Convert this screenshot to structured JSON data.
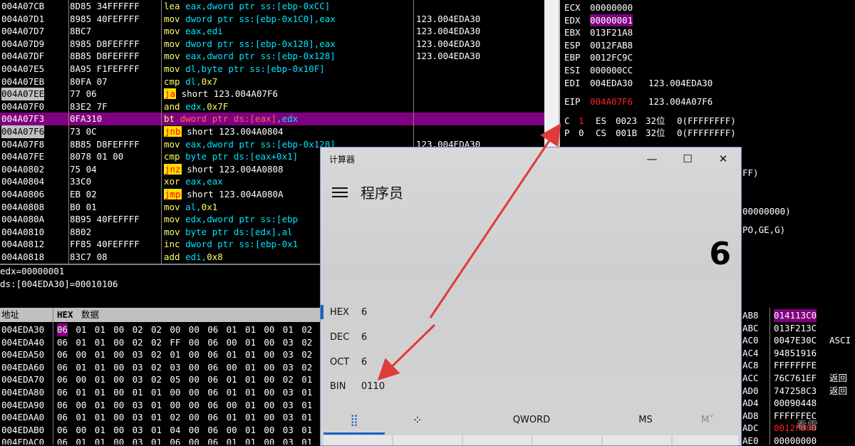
{
  "disasm": {
    "rows": [
      {
        "addr": "004A07CB",
        "hex": "8D85 34FFFFFF",
        "dis": [
          [
            "lea ",
            "mnem"
          ],
          [
            "eax,dword ptr ss:[ebp-0xCC]",
            "ops"
          ]
        ],
        "cmt": ""
      },
      {
        "addr": "004A07D1",
        "hex": "8985 40FEFFFF",
        "dis": [
          [
            "mov ",
            "mnem"
          ],
          [
            "dword ptr ss:[ebp-0x1C0],eax",
            "ops"
          ]
        ],
        "cmt": "123.004EDA30"
      },
      {
        "addr": "004A07D7",
        "hex": "8BC7",
        "dis": [
          [
            "mov ",
            "mnem"
          ],
          [
            "eax,edi",
            "ops"
          ]
        ],
        "cmt": "123.004EDA30"
      },
      {
        "addr": "004A07D9",
        "hex": "8985 D8FEFFFF",
        "dis": [
          [
            "mov ",
            "mnem"
          ],
          [
            "dword ptr ss:[ebp-0x128],eax",
            "ops"
          ]
        ],
        "cmt": "123.004EDA30"
      },
      {
        "addr": "004A07DF",
        "hex": "8B85 D8FEFFFF",
        "dis": [
          [
            "mov ",
            "mnem"
          ],
          [
            "eax,dword ptr ss:[ebp-0x128]",
            "ops"
          ]
        ],
        "cmt": "123.004EDA30"
      },
      {
        "addr": "004A07E5",
        "hex": "8A95 F1FEFFFF",
        "dis": [
          [
            "mov ",
            "mnem"
          ],
          [
            "dl,byte ptr ss:[ebp-0x10F]",
            "ops"
          ]
        ],
        "cmt": ""
      },
      {
        "addr": "004A07EB",
        "hex": "80FA 07",
        "dis": [
          [
            "cmp ",
            "mnem"
          ],
          [
            "dl,",
            "ops"
          ],
          [
            "0x7",
            "num"
          ]
        ],
        "cmt": ""
      },
      {
        "addr": "004A07EE",
        "hex": "77 06",
        "dis": [
          [
            "ja",
            "jmp"
          ],
          [
            " short 123.004A07F6",
            "plain"
          ]
        ],
        "cmt": "",
        "addrcls": "cur-addr"
      },
      {
        "addr": "004A07F0",
        "hex": "83E2 7F",
        "dis": [
          [
            "and ",
            "mnem"
          ],
          [
            "edx,",
            "ops"
          ],
          [
            "0x7F",
            "num"
          ]
        ],
        "cmt": ""
      },
      {
        "addr": "004A07F3",
        "hex": "0FA310",
        "dis": [
          [
            "bt ",
            "mnemhl"
          ],
          [
            "dword ptr ds:[eax]",
            "opshl"
          ],
          [
            ",edx",
            "plainhl"
          ]
        ],
        "cmt": "",
        "rowcls": "hl-purple"
      },
      {
        "addr": "004A07F6",
        "hex": "73 0C",
        "dis": [
          [
            "jnb",
            "jmp"
          ],
          [
            " short 123.004A0804",
            "plain"
          ]
        ],
        "cmt": "",
        "addrcls": "cur-addr"
      },
      {
        "addr": "004A07F8",
        "hex": "8B85 D8FEFFFF",
        "dis": [
          [
            "mov ",
            "mnem"
          ],
          [
            "eax,dword ptr ss:[ebp-0x128]",
            "ops"
          ]
        ],
        "cmt": "123.004EDA30"
      },
      {
        "addr": "004A07FE",
        "hex": "8078 01 00",
        "dis": [
          [
            "cmp ",
            "mnem"
          ],
          [
            "byte ptr ds:[eax+0x1]",
            "ops"
          ]
        ],
        "cmt": ""
      },
      {
        "addr": "004A0802",
        "hex": "75 04",
        "dis": [
          [
            "jnz",
            "jmp"
          ],
          [
            " short 123.004A0808",
            "plain"
          ]
        ],
        "cmt": ""
      },
      {
        "addr": "004A0804",
        "hex": "33C0",
        "dis": [
          [
            "xor ",
            "mnem"
          ],
          [
            "eax,eax",
            "ops"
          ]
        ],
        "cmt": ""
      },
      {
        "addr": "004A0806",
        "hex": "EB 02",
        "dis": [
          [
            "jmp",
            "jmp"
          ],
          [
            " short 123.004A080A",
            "plain"
          ]
        ],
        "cmt": ""
      },
      {
        "addr": "004A0808",
        "hex": "B0 01",
        "dis": [
          [
            "mov ",
            "mnem"
          ],
          [
            "al,",
            "ops"
          ],
          [
            "0x1",
            "num"
          ]
        ],
        "cmt": ""
      },
      {
        "addr": "004A080A",
        "hex": "8B95 40FEFFFF",
        "dis": [
          [
            "mov ",
            "mnem"
          ],
          [
            "edx,dword ptr ss:[ebp",
            "ops"
          ]
        ],
        "cmt": ""
      },
      {
        "addr": "004A0810",
        "hex": "8802",
        "dis": [
          [
            "mov ",
            "mnem"
          ],
          [
            "byte ptr ds:[edx],al",
            "ops"
          ]
        ],
        "cmt": ""
      },
      {
        "addr": "004A0812",
        "hex": "FF85 40FEFFFF",
        "dis": [
          [
            "inc ",
            "mnem"
          ],
          [
            "dword ptr ss:[ebp-0x1",
            "ops"
          ]
        ],
        "cmt": ""
      },
      {
        "addr": "004A0818",
        "hex": "83C7 08",
        "dis": [
          [
            "add ",
            "mnem"
          ],
          [
            "edi,",
            "ops"
          ],
          [
            "0x8",
            "num"
          ]
        ],
        "cmt": ""
      }
    ]
  },
  "info": {
    "line1": "edx=00000001",
    "line2": "ds:[004EDA30]=00010106"
  },
  "registers": {
    "top_partial": "",
    "rows": [
      {
        "name": "ECX",
        "value": "00000000",
        "extra": ""
      },
      {
        "name": "EDX",
        "value": "00000001",
        "extra": "",
        "hl": true
      },
      {
        "name": "EBX",
        "value": "013F21A8",
        "extra": ""
      },
      {
        "name": "ESP",
        "value": "0012FAB8",
        "extra": ""
      },
      {
        "name": "EBP",
        "value": "0012FC9C",
        "extra": ""
      },
      {
        "name": "ESI",
        "value": "000000CC",
        "extra": ""
      },
      {
        "name": "EDI",
        "value": "004EDA30",
        "extra": "123.004EDA30"
      }
    ],
    "eip": {
      "name": "EIP",
      "value": "004A07F6",
      "extra": "123.004A07F6"
    },
    "flags": [
      {
        "flag": "C",
        "bit": "1",
        "seg": "ES",
        "sel": "0023",
        "bits": "32位",
        "base": "0(FFFFFFFF)",
        "bitred": true
      },
      {
        "flag": "P",
        "bit": "0",
        "seg": "CS",
        "sel": "001B",
        "bits": "32位",
        "base": "0(FFFFFFFF)",
        "bitred": false
      }
    ],
    "peek": [
      "FF)",
      "00000000)",
      "PO,GE,G)"
    ]
  },
  "dump": {
    "header": {
      "addr": "地址",
      "hex": "HEX",
      "data": "数据"
    },
    "rows": [
      {
        "addr": "004EDA30",
        "bytes": [
          "06",
          "01",
          "01",
          "00",
          "02",
          "02",
          "00",
          "00",
          "06",
          "01",
          "01",
          "00",
          "01",
          "02"
        ]
      },
      {
        "addr": "004EDA40",
        "bytes": [
          "06",
          "01",
          "01",
          "00",
          "02",
          "02",
          "FF",
          "00",
          "06",
          "00",
          "01",
          "00",
          "03",
          "02"
        ]
      },
      {
        "addr": "004EDA50",
        "bytes": [
          "06",
          "00",
          "01",
          "00",
          "03",
          "02",
          "01",
          "00",
          "06",
          "01",
          "01",
          "00",
          "03",
          "02"
        ]
      },
      {
        "addr": "004EDA60",
        "bytes": [
          "06",
          "01",
          "01",
          "00",
          "03",
          "02",
          "03",
          "00",
          "06",
          "00",
          "01",
          "00",
          "03",
          "02"
        ]
      },
      {
        "addr": "004EDA70",
        "bytes": [
          "06",
          "00",
          "01",
          "00",
          "03",
          "02",
          "05",
          "00",
          "06",
          "01",
          "01",
          "00",
          "02",
          "01"
        ]
      },
      {
        "addr": "004EDA80",
        "bytes": [
          "06",
          "01",
          "01",
          "00",
          "01",
          "01",
          "00",
          "00",
          "06",
          "01",
          "01",
          "00",
          "03",
          "01"
        ]
      },
      {
        "addr": "004EDA90",
        "bytes": [
          "06",
          "00",
          "01",
          "00",
          "03",
          "01",
          "00",
          "00",
          "06",
          "00",
          "01",
          "00",
          "03",
          "01"
        ]
      },
      {
        "addr": "004EDAA0",
        "bytes": [
          "06",
          "01",
          "01",
          "00",
          "03",
          "01",
          "02",
          "00",
          "06",
          "01",
          "01",
          "00",
          "03",
          "01"
        ]
      },
      {
        "addr": "004EDAB0",
        "bytes": [
          "06",
          "00",
          "01",
          "00",
          "03",
          "01",
          "04",
          "00",
          "06",
          "00",
          "01",
          "00",
          "03",
          "01"
        ]
      },
      {
        "addr": "004EDAC0",
        "bytes": [
          "06",
          "01",
          "01",
          "00",
          "03",
          "01",
          "06",
          "00",
          "06",
          "01",
          "01",
          "00",
          "03",
          "01"
        ]
      }
    ]
  },
  "stack": {
    "rows": [
      {
        "addr": "AB8",
        "value": "014113C0",
        "cmt": "",
        "sel": true
      },
      {
        "addr": "ABC",
        "value": "013F213C",
        "cmt": ""
      },
      {
        "addr": "AC0",
        "value": "0047E30C",
        "cmt": "ASCI"
      },
      {
        "addr": "AC4",
        "value": "94851916",
        "cmt": ""
      },
      {
        "addr": "AC8",
        "value": "FFFFFFFE",
        "cmt": ""
      },
      {
        "addr": "ACC",
        "value": "76C761EF",
        "cmt": "返回"
      },
      {
        "addr": "AD0",
        "value": "747258C3",
        "cmt": "返回"
      },
      {
        "addr": "AD4",
        "value": "00090448",
        "cmt": ""
      },
      {
        "addr": "AD8",
        "value": "FFFFFFEC",
        "cmt": ""
      },
      {
        "addr": "ADC",
        "value": "0012FB00",
        "cmt": "",
        "red": true
      },
      {
        "addr": "AE0",
        "value": "00000000",
        "cmt": ""
      }
    ]
  },
  "calculator": {
    "window_title": "计算器",
    "minimize": "—",
    "maximize": "☐",
    "close": "✕",
    "mode": "程序员",
    "display": "6",
    "bases": [
      {
        "name": "HEX",
        "value": "6",
        "selected": true
      },
      {
        "name": "DEC",
        "value": "6"
      },
      {
        "name": "OCT",
        "value": "6"
      },
      {
        "name": "BIN",
        "value": "0110"
      }
    ],
    "tabs": {
      "keypad": "⣿",
      "bits": "⁘",
      "word": "QWORD",
      "ms": "MS",
      "mplus": "M˅"
    }
  },
  "watermark": "看雪",
  "colors": {
    "accent": "#1565c0",
    "highlight": "#800080",
    "arrow": "#e03a3a"
  }
}
